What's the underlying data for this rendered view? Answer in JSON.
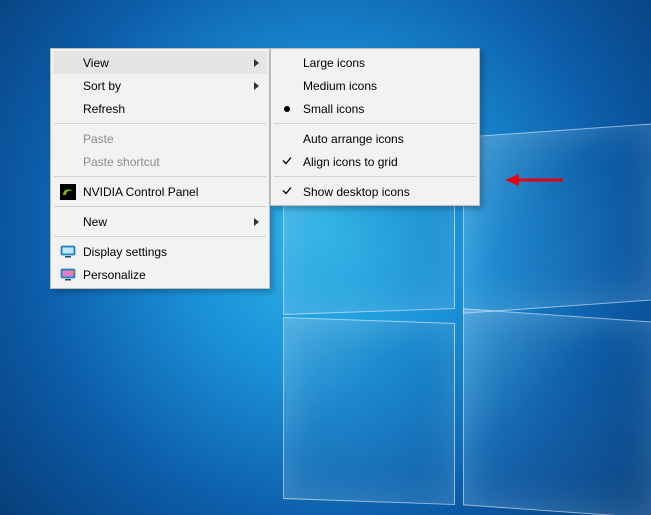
{
  "context_menu": {
    "view": "View",
    "sort_by": "Sort by",
    "refresh": "Refresh",
    "paste": "Paste",
    "paste_shortcut": "Paste shortcut",
    "nvidia": "NVIDIA Control Panel",
    "new": "New",
    "display_settings": "Display settings",
    "personalize": "Personalize"
  },
  "view_submenu": {
    "large_icons": "Large icons",
    "medium_icons": "Medium icons",
    "small_icons": "Small icons",
    "auto_arrange": "Auto arrange icons",
    "align_grid": "Align icons to grid",
    "show_desktop_icons": "Show desktop icons"
  }
}
